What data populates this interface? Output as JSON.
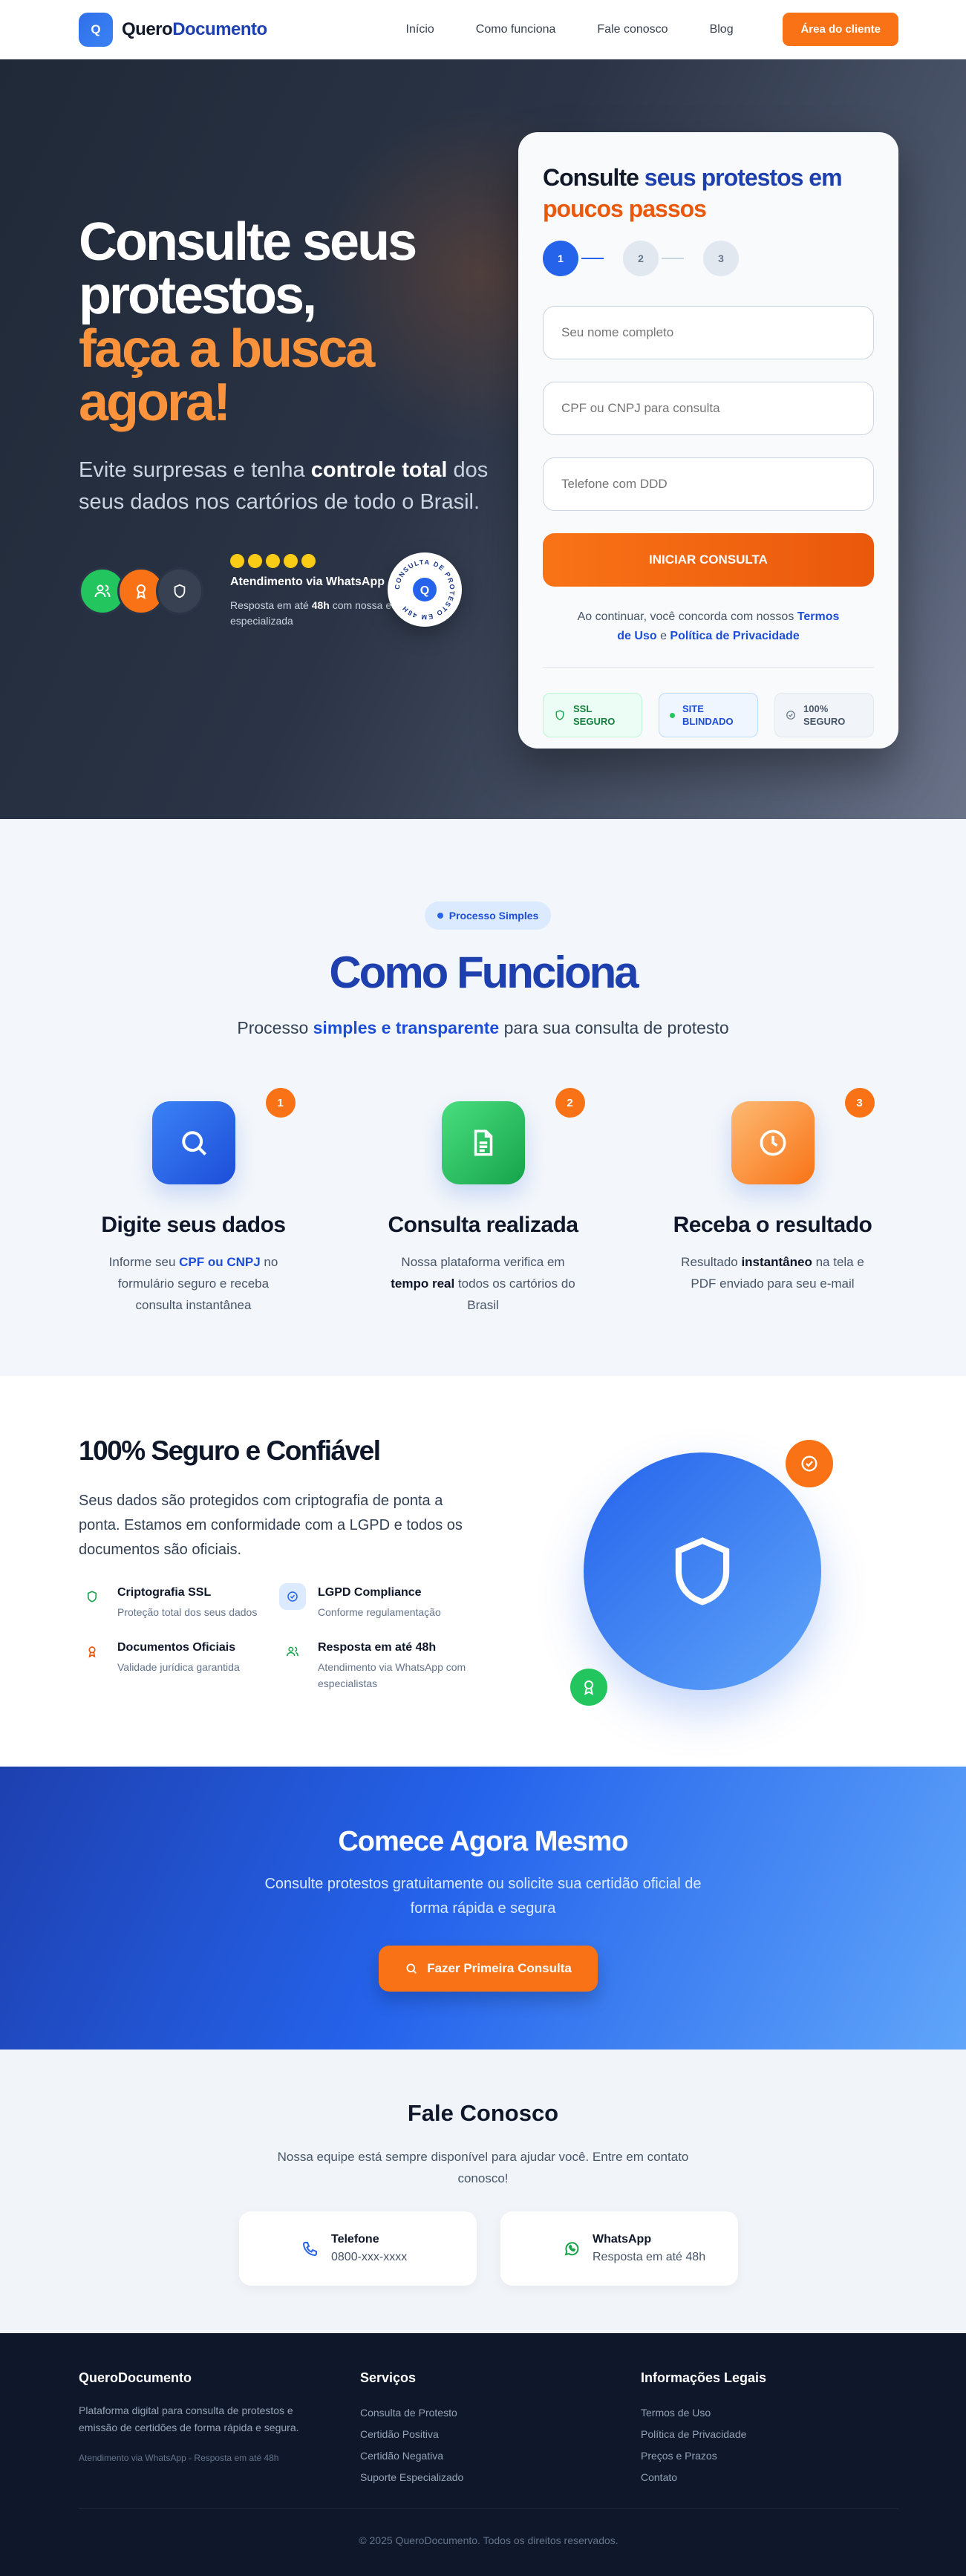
{
  "brand": {
    "logo_letter": "Q",
    "name_prefix": "Quero",
    "name_accent": "Documento"
  },
  "nav": {
    "links": [
      "Início",
      "Como funciona",
      "Fale conosco",
      "Blog"
    ],
    "cta": "Área do cliente"
  },
  "hero": {
    "title_line1": "Consulte seus",
    "title_line2": "protestos,",
    "title_line3": "faça a busca",
    "title_line4": "agora!",
    "subtitle_pre": "Evite surpresas e tenha ",
    "subtitle_bold": "controle total",
    "subtitle_post": " dos seus dados nos cartórios de todo o Brasil.",
    "trust_title": "Atendimento via WhatsApp",
    "trust_desc_pre": "Resposta em até ",
    "trust_desc_bold": "48h",
    "trust_desc_post": " com nossa equipe especializada",
    "seal_text": "CONSULTA DE PROTESTO EM 48H",
    "seal_letter": "Q",
    "stars": 5
  },
  "form": {
    "title_pre": "Consulte ",
    "title_blue": "seus protestos",
    "title_mid": " em ",
    "title_orange": "poucos passos",
    "steps": [
      "1",
      "2",
      "3"
    ],
    "name_placeholder": "Seu nome completo",
    "doc_placeholder": "CPF ou CNPJ para consulta",
    "phone_placeholder": "Telefone com DDD",
    "submit": "INICIAR CONSULTA",
    "terms_pre": "Ao continuar, você concorda com nossos ",
    "terms_link": "Termos de Uso",
    "terms_mid": " e ",
    "privacy_link": "Política de Privacidade",
    "badges": [
      {
        "line1": "SSL",
        "line2": "SEGURO"
      },
      {
        "line1": "SITE",
        "line2": "BLINDADO"
      },
      {
        "line1": "100%",
        "line2": "SEGURO"
      }
    ]
  },
  "how": {
    "pill": "Processo Simples",
    "title": "Como Funciona",
    "sub_pre": "Processo ",
    "sub_bold": "simples e transparente",
    "sub_post": " para sua consulta de protesto",
    "steps": [
      {
        "num": "1",
        "title": "Digite seus dados",
        "desc_pre": "Informe seu ",
        "desc_bold": "CPF ou CNPJ",
        "desc_post": " no formulário seguro e receba consulta instantânea"
      },
      {
        "num": "2",
        "title": "Consulta realizada",
        "desc_pre": "Nossa plataforma verifica em ",
        "desc_bold": "tempo real",
        "desc_post": " todos os cartórios do Brasil"
      },
      {
        "num": "3",
        "title": "Receba o resultado",
        "desc_pre": "Resultado ",
        "desc_bold": "instantâneo",
        "desc_post": " na tela e PDF enviado para seu e-mail"
      }
    ]
  },
  "secure": {
    "title": "100% Seguro e Confiável",
    "desc": "Seus dados são protegidos com criptografia de ponta a ponta. Estamos em conformidade com a LGPD e todos os documentos são oficiais.",
    "features": [
      {
        "title": "Criptografia SSL",
        "desc": "Proteção total dos seus dados"
      },
      {
        "title": "LGPD Compliance",
        "desc": "Conforme regulamentação"
      },
      {
        "title": "Documentos Oficiais",
        "desc": "Validade jurídica garantida"
      },
      {
        "title": "Resposta em até 48h",
        "desc": "Atendimento via WhatsApp com especialistas"
      }
    ]
  },
  "cta": {
    "title": "Comece Agora Mesmo",
    "sub": "Consulte protestos gratuitamente ou solicite sua certidão oficial de forma rápida e segura",
    "button": "Fazer Primeira Consulta"
  },
  "contact": {
    "title": "Fale Conosco",
    "sub": "Nossa equipe está sempre disponível para ajudar você. Entre em contato conosco!",
    "cards": [
      {
        "name": "Telefone",
        "value": "0800-xxx-xxxx"
      },
      {
        "name": "WhatsApp",
        "value": "Resposta em até 48h"
      }
    ]
  },
  "footer": {
    "brand": "QueroDocumento",
    "brand_desc": "Plataforma digital para consulta de protestos e emissão de certidões de forma rápida e segura.",
    "brand_small": "Atendimento via WhatsApp - Resposta em até 48h",
    "services_title": "Serviços",
    "services": [
      "Consulta de Protesto",
      "Certidão Positiva",
      "Certidão Negativa",
      "Suporte Especializado"
    ],
    "legal_title": "Informações Legais",
    "legal": [
      "Termos de Uso",
      "Política de Privacidade",
      "Preços e Prazos",
      "Contato"
    ],
    "copyright": "© 2025 QueroDocumento. Todos os direitos reservados."
  },
  "colors": {
    "primary": "#2563eb",
    "accent": "#f97316",
    "success": "#22c55e",
    "dark": "#0f172a"
  }
}
